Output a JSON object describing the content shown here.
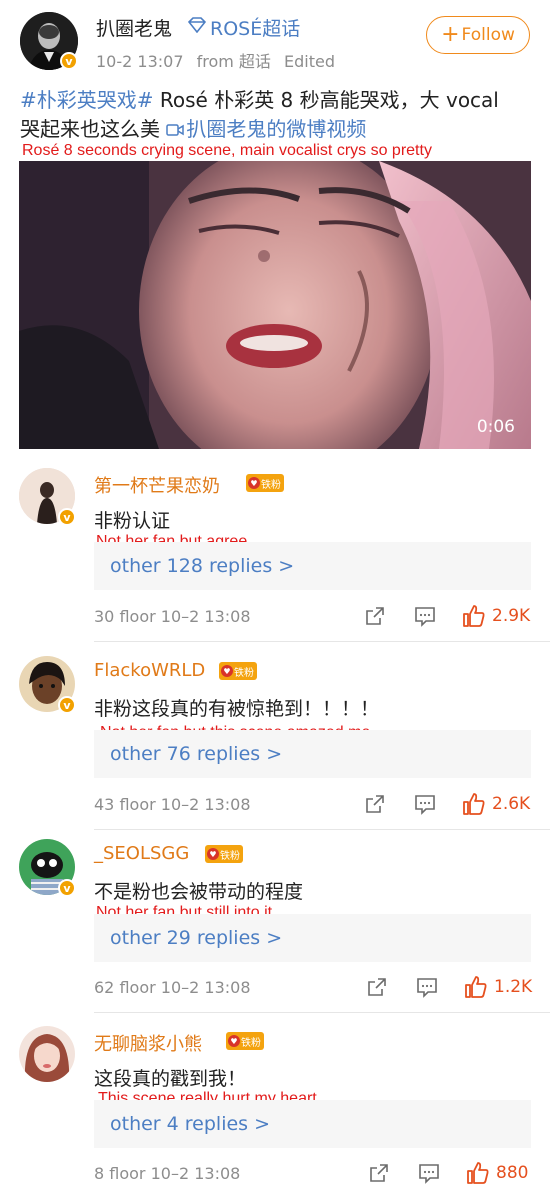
{
  "post": {
    "username": "扒圈老鬼",
    "group": "ROSÉ超话",
    "date": "10-2 13:07",
    "from_label": "from 超话",
    "edited": "Edited",
    "follow_label": "Follow",
    "hashtag": "#朴彩英哭戏#",
    "text_line1": " Rosé 朴彩英 8 秒高能哭戏，大 vocal",
    "text_line2": "哭起来也这么美 ",
    "video_link": "扒圈老鬼的微博视频",
    "translation": "Rosé 8 seconds crying scene, main vocalist crys so pretty",
    "video_duration": "0:06"
  },
  "comments": [
    {
      "name": "第一杯芒果恋奶",
      "badge": "铁粉",
      "text": "非粉认证",
      "translation": "Not her fan but agree",
      "replies": "other 128 replies >",
      "floor": "30 floor 10–2 13:08",
      "likes": "2.9K"
    },
    {
      "name": "FlackoWRLD",
      "badge": "铁粉",
      "text": "非粉这段真的有被惊艳到！！！！",
      "translation": "Not her fan but this scene amazed me",
      "replies": "other 76 replies >",
      "floor": "43 floor 10–2 13:08",
      "likes": "2.6K"
    },
    {
      "name": "_SEOLSGG",
      "badge": "铁粉",
      "text": "不是粉也会被带动的程度",
      "translation": "Not her fan but still into it",
      "replies": "other 29 replies >",
      "floor": "62 floor 10–2 13:08",
      "likes": "1.2K"
    },
    {
      "name": "无聊脑浆小熊",
      "badge": "铁粉",
      "text": "这段真的戳到我！",
      "translation": "This scene really hurt my heart",
      "replies": "other 4 replies >",
      "floor": "8 floor 10–2 13:08",
      "likes": "880"
    }
  ],
  "icons": {
    "verified_badge": "v",
    "follow_plus": "+"
  },
  "colors": {
    "accent_orange": "#f08a1c",
    "link_blue": "#4c7ec3",
    "translation_red": "#e21b1b",
    "like_orange": "#e5501f"
  }
}
